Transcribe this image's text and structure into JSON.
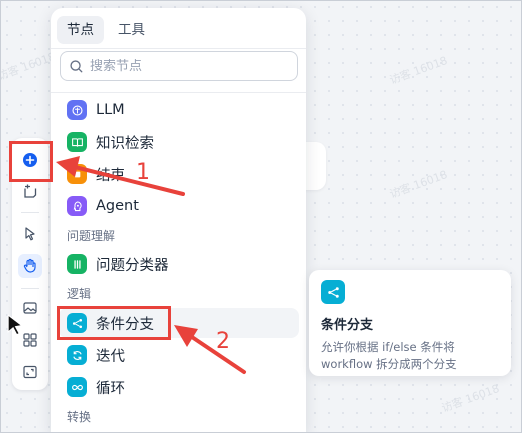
{
  "tabs": [
    {
      "label": "节点",
      "active": true
    },
    {
      "label": "工具",
      "active": false
    }
  ],
  "search": {
    "placeholder": "搜索节点",
    "value": ""
  },
  "nodes": {
    "llm": {
      "label": "LLM",
      "icon": "llm-icon",
      "color": "#6172f3"
    },
    "knowledge": {
      "label": "知识检索",
      "icon": "book-icon",
      "color": "#16b364"
    },
    "end": {
      "label": "结束",
      "icon": "end-icon",
      "color": "#f79009"
    },
    "agent": {
      "label": "Agent",
      "icon": "agent-icon",
      "color": "#875bf7"
    },
    "group_understanding": "问题理解",
    "classifier": {
      "label": "问题分类器",
      "icon": "classifier-icon",
      "color": "#16b364"
    },
    "group_logic": "逻辑",
    "ifelse": {
      "label": "条件分支",
      "icon": "branch-icon",
      "color": "#06aed4"
    },
    "iteration": {
      "label": "迭代",
      "icon": "iteration-icon",
      "color": "#06aed4"
    },
    "loop": {
      "label": "循环",
      "icon": "loop-icon",
      "color": "#06aed4"
    },
    "group_transform": "转换"
  },
  "card": {
    "title": "条件分支",
    "description": "允许你根据 if/else 条件将 workflow 拆分成两个分支",
    "icon": "branch-icon",
    "color": "#06aed4"
  },
  "toolbar": {
    "items": [
      "add-node",
      "add-note",
      "pointer",
      "hand",
      "export-image",
      "organize",
      "fit-view"
    ],
    "active": "hand"
  },
  "annotations": {
    "step1": "1",
    "step2": "2",
    "color": "#e8423b"
  },
  "watermark": "访客 16018"
}
